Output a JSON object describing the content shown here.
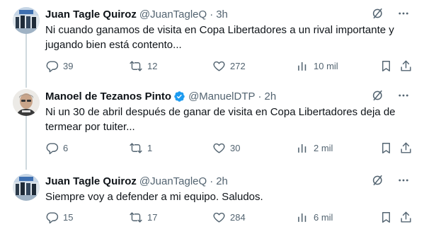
{
  "tweets": [
    {
      "author_name": "Juan Tagle Quiroz",
      "handle": "@JuanTagleQ",
      "separator": "·",
      "time": "3h",
      "verified": false,
      "text": "Ni cuando ganamos de visita en Copa Libertadores a un rival importante y\njugando bien está contento...",
      "replies": "39",
      "retweets": "12",
      "likes": "272",
      "views": "10 mil"
    },
    {
      "author_name": "Manoel de Tezanos Pinto",
      "handle": "@ManuelDTP",
      "separator": "·",
      "time": "2h",
      "verified": true,
      "text": "Ni un 30 de abril después de ganar de visita en Copa Libertadores deja de\ntermear por tuiter...",
      "replies": "6",
      "retweets": "1",
      "likes": "30",
      "views": "2 mil"
    },
    {
      "author_name": "Juan Tagle Quiroz",
      "handle": "@JuanTagleQ",
      "separator": "·",
      "time": "2h",
      "verified": false,
      "text": "Siempre voy a defender a mi equipo. Saludos.",
      "replies": "15",
      "retweets": "17",
      "likes": "284",
      "views": "6 mil"
    }
  ],
  "icons": {
    "reply": "reply-icon",
    "retweet": "retweet-icon",
    "like": "heart-icon",
    "views": "views-icon",
    "bookmark": "bookmark-icon",
    "share": "share-icon",
    "grok": "grok-icon",
    "more": "more-icon",
    "verified": "verified-badge-icon"
  },
  "colors": {
    "text": "#0f1419",
    "secondary": "#536471",
    "verified": "#1d9bf0",
    "thread_line": "#cfd9de"
  }
}
